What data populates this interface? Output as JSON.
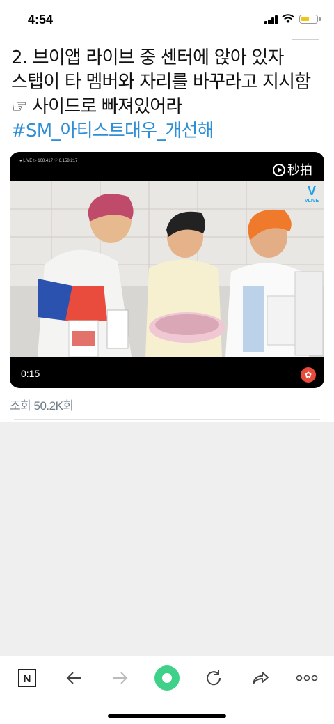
{
  "status_bar": {
    "time": "4:54"
  },
  "post": {
    "line1": "2. 브이앱 라이브 중 센터에 앉아 있자",
    "line2": "스탭이 타 멤버와 자리를 바꾸라고 지시함",
    "line3": "☞ 사이드로 빠져있어라",
    "hashtag": "#SM_아티스트대우_개선해"
  },
  "video": {
    "time": "0:15",
    "logo_text": "秒拍",
    "vlive_text": "VLIVE",
    "playing": true
  },
  "view_count": "조회 50.2K회",
  "toolbar": {
    "items": [
      "naver-icon",
      "back-arrow-icon",
      "forward-arrow-icon",
      "home-icon",
      "refresh-icon",
      "share-icon",
      "more-icon"
    ]
  },
  "colors": {
    "hashtag": "#2f8fd6",
    "home_button": "#3fd18a"
  }
}
